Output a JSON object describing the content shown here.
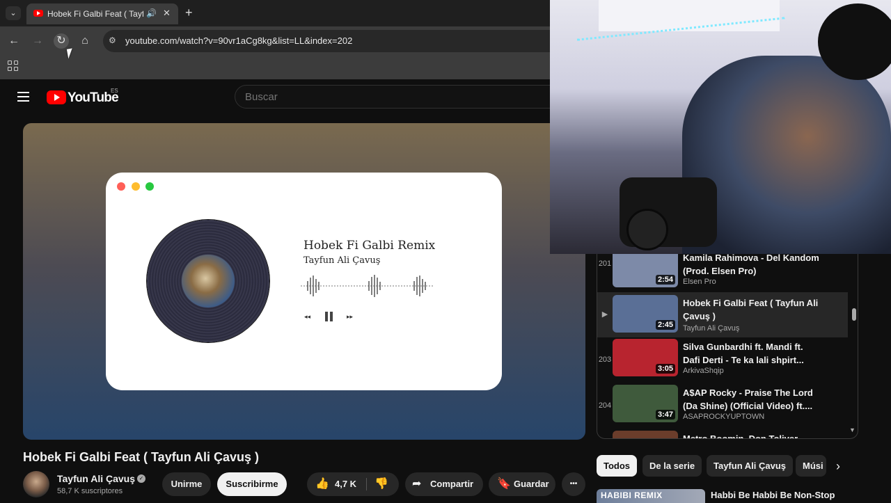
{
  "browser": {
    "tab_title": "Hobek Fi Galbi Feat ( Tayfun Ali Çavuş )",
    "url": "youtube.com/watch?v=90vr1aCg8kg&list=LL&index=202",
    "new_tab": "+",
    "close": "✕",
    "audio_icon": "🔊"
  },
  "masthead": {
    "logo_text": "YouTube",
    "country_code": "ES",
    "search_placeholder": "Buscar"
  },
  "player_card": {
    "song_title": "Hobek Fi Galbi Remix",
    "song_artist": "Tayfun Ali Çavuş",
    "prev": "◂◂",
    "next": "▸▸"
  },
  "video": {
    "title": "Hobek Fi Galbi Feat ( Tayfun Ali Çavuş )",
    "channel": "Tayfun Ali Çavuş",
    "subscribers": "58,7 K suscriptores",
    "join_label": "Unirme",
    "subscribe_label": "Suscribirme",
    "likes": "4,7 K",
    "share_label": "Compartir",
    "save_label": "Guardar",
    "more_label": "•••"
  },
  "playlist": {
    "items": [
      {
        "index": "201",
        "title": "Kamila Rahimova - Del Kandom (Prod. Elsen Pro)",
        "channel": "Elsen Pro",
        "duration": "2:54",
        "thumb_color": "#7d8aa8"
      },
      {
        "index": "▶",
        "title": "Hobek Fi Galbi Feat ( Tayfun Ali Çavuş )",
        "channel": "Tayfun Ali Çavuş",
        "duration": "2:45",
        "thumb_color": "#5a6f96"
      },
      {
        "index": "203",
        "title": "Silva Gunbardhi ft. Mandi ft. Dafi Derti - Te ka lali shpirt...",
        "channel": "ArkivaShqip",
        "duration": "3:05",
        "thumb_color": "#b8242f"
      },
      {
        "index": "204",
        "title": "A$AP Rocky - Praise The Lord (Da Shine) (Official Video) ft....",
        "channel": "ASAPROCKYUPTOWN",
        "duration": "3:47",
        "thumb_color": "#3f5a3c"
      },
      {
        "index": "",
        "title": "Metro Boomin, Don Toliver...",
        "channel": "",
        "duration": "",
        "thumb_color": "#6b3d2b"
      }
    ]
  },
  "chips": [
    "Todos",
    "De la serie",
    "Tayfun Ali Çavuş",
    "Músi"
  ],
  "related": {
    "thumb_text": "HABIBI REMIX",
    "title": "Habbi Be Habbi Be Non-Stop"
  },
  "colors": {
    "accent": "#ff0000",
    "background": "#0f0f0f",
    "mac_red": "#ff5f57",
    "mac_yellow": "#febc2e",
    "mac_green": "#28c840"
  }
}
